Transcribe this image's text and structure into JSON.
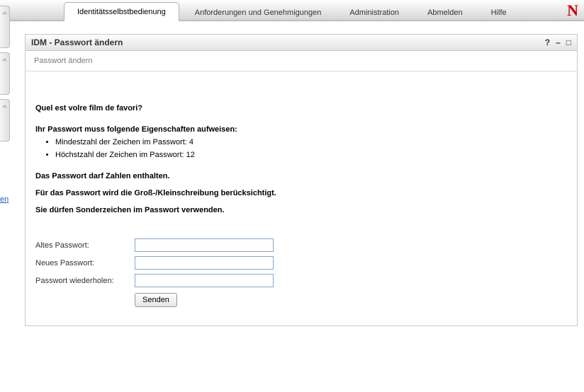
{
  "logo_text": "N",
  "tabs": {
    "t0": "Identitätsselbstbedienung",
    "t1": "Anforderungen und Genehmigungen",
    "t2": "Administration",
    "t3": "Abmelden",
    "t4": "Hilfe"
  },
  "left_partial_link": "en",
  "panel": {
    "title": "IDM - Passwort ändern",
    "subtitle": "Passwort ändern",
    "help_glyph": "?",
    "min_glyph": "–",
    "max_glyph": "□"
  },
  "body": {
    "question": "Quel est volre film de favori?",
    "rules_heading": "Ihr Passwort muss folgende Eigenschaften aufweisen:",
    "rule1": "Mindestzahl der Zeichen im Passwort: 4",
    "rule2": "Höchstzahl der Zeichen im Passwort: 12",
    "line1": "Das Passwort darf Zahlen enthalten.",
    "line2": "Für das Passwort wird die Groß-/Kleinschreibung berücksichtigt.",
    "line3": "Sie dürfen Sonderzeichen im Passwort verwenden."
  },
  "form": {
    "old_label": "Altes Passwort:",
    "new_label": "Neues Passwort:",
    "repeat_label": "Passwort wiederholen:",
    "submit": "Senden"
  }
}
